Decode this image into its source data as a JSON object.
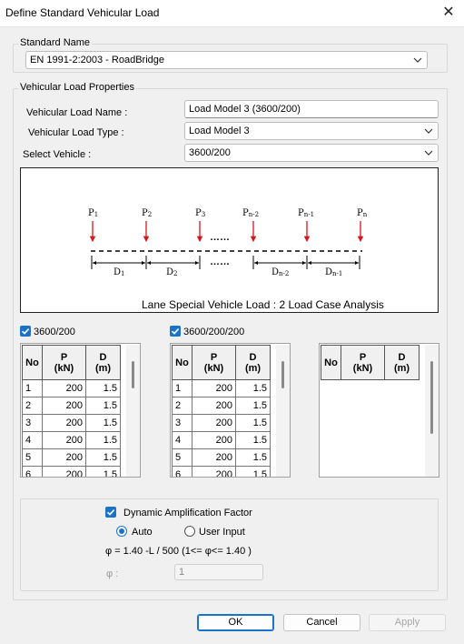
{
  "window": {
    "title": "Define Standard Vehicular Load",
    "close_glyph": "✕"
  },
  "standard": {
    "group_label": "Standard Name",
    "value": "EN 1991-2:2003 - RoadBridge"
  },
  "properties": {
    "group_label": "Vehicular Load Properties",
    "name_label": "Vehicular Load Name :",
    "name_value": "Load Model 3 (3600/200)",
    "type_label": "Vehicular Load Type :",
    "type_value": "Load Model 3",
    "vehicle_label": "Select Vehicle :",
    "vehicle_value": "3600/200"
  },
  "diagram": {
    "loads": [
      {
        "base": "P",
        "sub": "1"
      },
      {
        "base": "P",
        "sub": "2"
      },
      {
        "base": "P",
        "sub": "3"
      },
      {
        "base": "P",
        "sub": "n-2"
      },
      {
        "base": "P",
        "sub": "n-1"
      },
      {
        "base": "P",
        "sub": "n"
      }
    ],
    "ellipsis": "……",
    "spacings": [
      {
        "base": "D",
        "sub": "1"
      },
      {
        "base": "D",
        "sub": "2"
      },
      {
        "base": "D",
        "sub": "n-2"
      },
      {
        "base": "D",
        "sub": "n-1"
      }
    ],
    "caption": "Lane Special Vehicle Load : 2 Load Case Analysis",
    "arrow_color": "#d8141e"
  },
  "tables": {
    "table1": {
      "checkbox_label": "3600/200",
      "headers": {
        "no": "No",
        "p": "P",
        "p_unit": "(kN)",
        "d": "D",
        "d_unit": "(m)"
      },
      "rows": [
        {
          "no": "1",
          "p": "200",
          "d": "1.5"
        },
        {
          "no": "2",
          "p": "200",
          "d": "1.5"
        },
        {
          "no": "3",
          "p": "200",
          "d": "1.5"
        },
        {
          "no": "4",
          "p": "200",
          "d": "1.5"
        },
        {
          "no": "5",
          "p": "200",
          "d": "1.5"
        },
        {
          "no": "6",
          "p": "200",
          "d": "1.5"
        }
      ]
    },
    "table2": {
      "checkbox_label": "3600/200/200",
      "headers": {
        "no": "No",
        "p": "P",
        "p_unit": "(kN)",
        "d": "D",
        "d_unit": "(m)"
      },
      "rows": [
        {
          "no": "1",
          "p": "200",
          "d": "1.5"
        },
        {
          "no": "2",
          "p": "200",
          "d": "1.5"
        },
        {
          "no": "3",
          "p": "200",
          "d": "1.5"
        },
        {
          "no": "4",
          "p": "200",
          "d": "1.5"
        },
        {
          "no": "5",
          "p": "200",
          "d": "1.5"
        },
        {
          "no": "6",
          "p": "200",
          "d": "1.5"
        }
      ]
    },
    "table3": {
      "headers": {
        "no": "No",
        "p": "P",
        "p_unit": "(kN)",
        "d": "D",
        "d_unit": "(m)"
      }
    }
  },
  "daf": {
    "checkbox_label": "Dynamic Amplification Factor",
    "radio_auto": "Auto",
    "radio_user": "User Input",
    "formula": "φ = 1.40 -L / 500  (1<= φ<= 1.40 )",
    "phi_label": "φ :",
    "phi_value": "1"
  },
  "buttons": {
    "ok": "OK",
    "cancel": "Cancel",
    "apply": "Apply"
  },
  "colors": {
    "accent": "#1a73c8",
    "arrow": "#d8141e"
  }
}
